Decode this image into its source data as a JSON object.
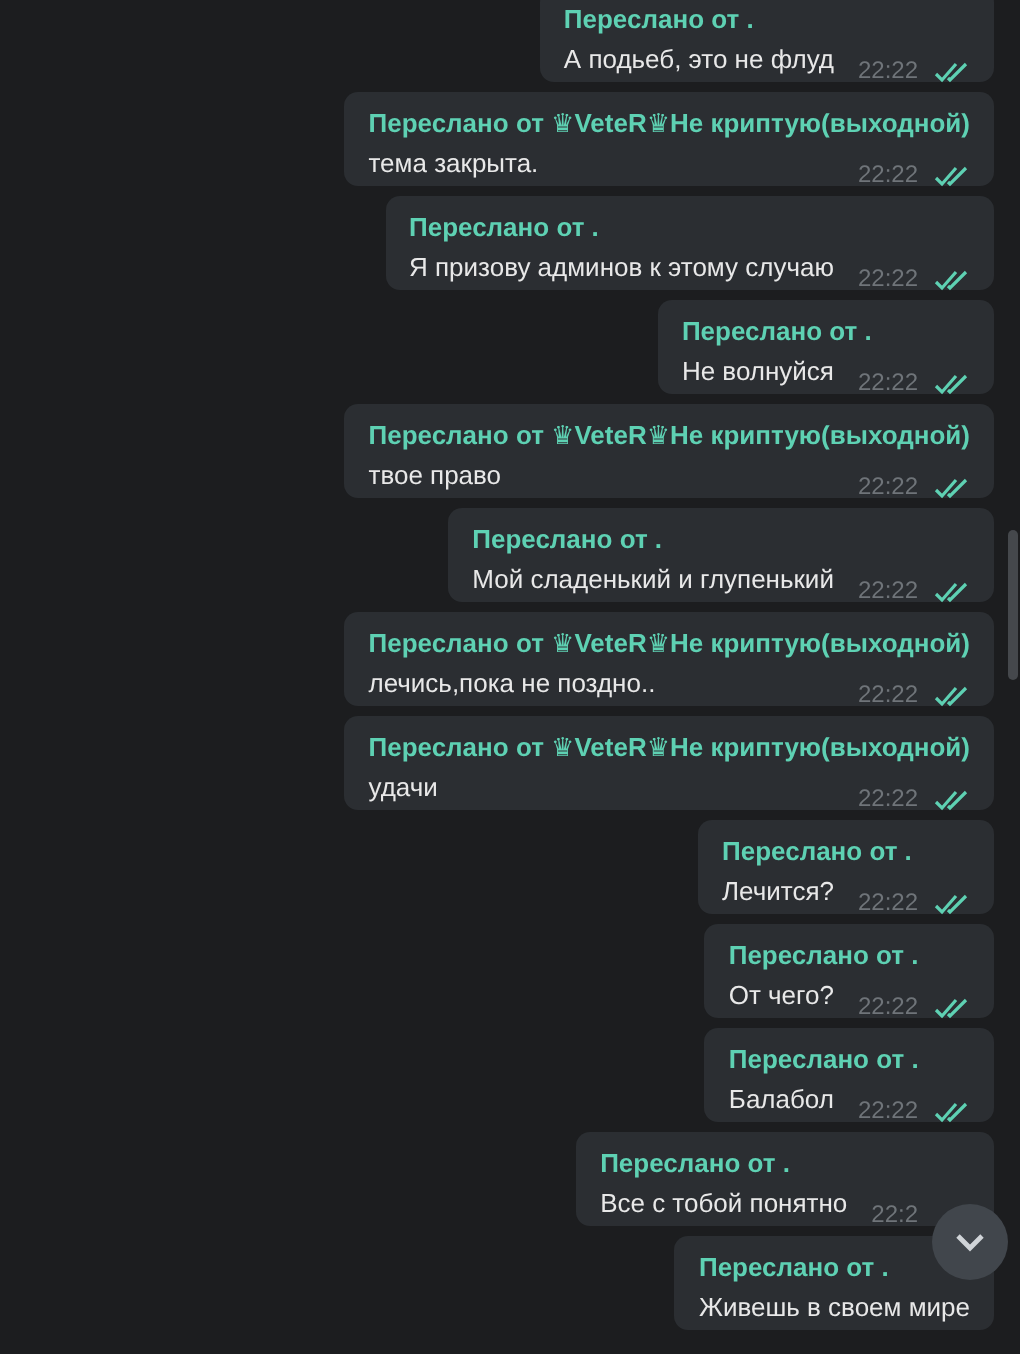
{
  "messages": [
    {
      "forwarded_from": "Переслано от .",
      "text": "А подьеб, это не флуд",
      "time": "22:22",
      "read": true
    },
    {
      "forwarded_from": "Переслано от ♛VeteR♛Не криптую(выходной)",
      "text": "тема закрыта.",
      "time": "22:22",
      "read": true
    },
    {
      "forwarded_from": "Переслано от .",
      "text": "Я призову админов к этому случаю",
      "time": "22:22",
      "read": true
    },
    {
      "forwarded_from": "Переслано от .",
      "text": "Не волнуйся",
      "time": "22:22",
      "read": true
    },
    {
      "forwarded_from": "Переслано от ♛VeteR♛Не криптую(выходной)",
      "text": "твое право",
      "time": "22:22",
      "read": true
    },
    {
      "forwarded_from": "Переслано от .",
      "text": "Мой сладенький и глупенький",
      "time": "22:22",
      "read": true
    },
    {
      "forwarded_from": "Переслано от ♛VeteR♛Не криптую(выходной)",
      "text": "лечись,пока не поздно..",
      "time": "22:22",
      "read": true
    },
    {
      "forwarded_from": "Переслано от ♛VeteR♛Не криптую(выходной)",
      "text": "удачи",
      "time": "22:22",
      "read": true
    },
    {
      "forwarded_from": "Переслано от .",
      "text": "Лечится?",
      "time": "22:22",
      "read": true
    },
    {
      "forwarded_from": "Переслано от .",
      "text": "От чего?",
      "time": "22:22",
      "read": true
    },
    {
      "forwarded_from": "Переслано от .",
      "text": "Балабол",
      "time": "22:22",
      "read": true
    },
    {
      "forwarded_from": "Переслано от .",
      "text": "Все с тобой понятно",
      "time": "22:2"
    },
    {
      "forwarded_from": "Переслано от .",
      "text": "Живешь в своем мире"
    }
  ]
}
